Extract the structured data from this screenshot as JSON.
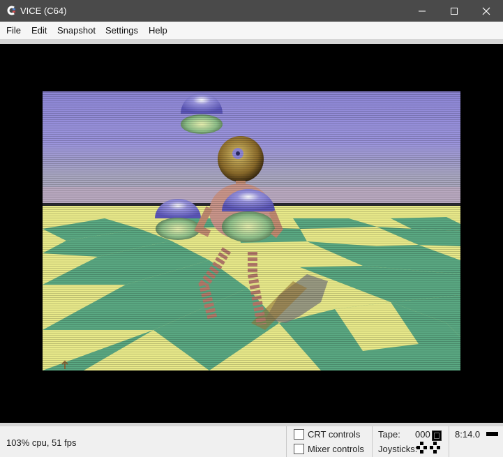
{
  "window": {
    "title": "VICE (C64)"
  },
  "window_controls": {
    "minimize": "—",
    "maximize": "☐",
    "close": "✕"
  },
  "menu": [
    "File",
    "Edit",
    "Snapshot",
    "Settings",
    "Help"
  ],
  "status": {
    "cpu_fps": "103% cpu, 51 fps",
    "crt_label": "CRT controls",
    "mixer_label": "Mixer controls",
    "tape_label": "Tape:",
    "tape_counter": "000",
    "joysticks_label": "Joysticks:",
    "time": "8:14.0"
  }
}
